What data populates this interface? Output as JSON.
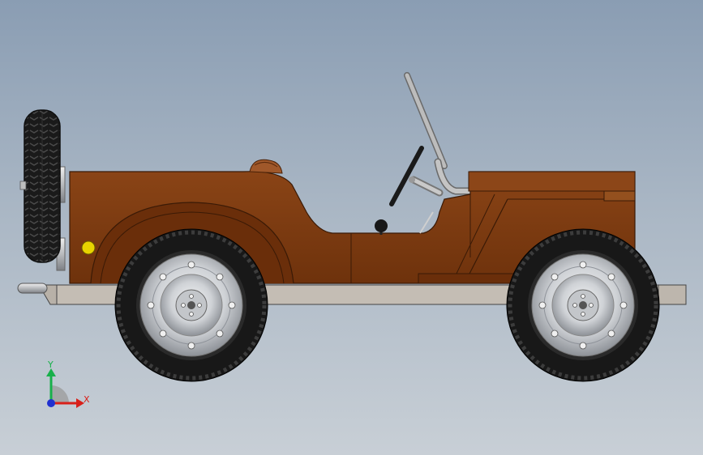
{
  "viewport": {
    "background_top": "#8a9db3",
    "background_bottom": "#c8cfd6"
  },
  "model": {
    "body_color": "#7a3a10",
    "body_dark": "#5e2a08",
    "chassis_color": "#c4bdb4",
    "tire_color": "#1b1b1b",
    "rim_color": "#d4d6d9",
    "light_color": "#e8d400",
    "seat_color": "#a0582a"
  },
  "triad": {
    "x_label": "X",
    "y_label": "Y",
    "x_color": "#d8201a",
    "y_color": "#18b04a",
    "z_color": "#2030d0"
  }
}
